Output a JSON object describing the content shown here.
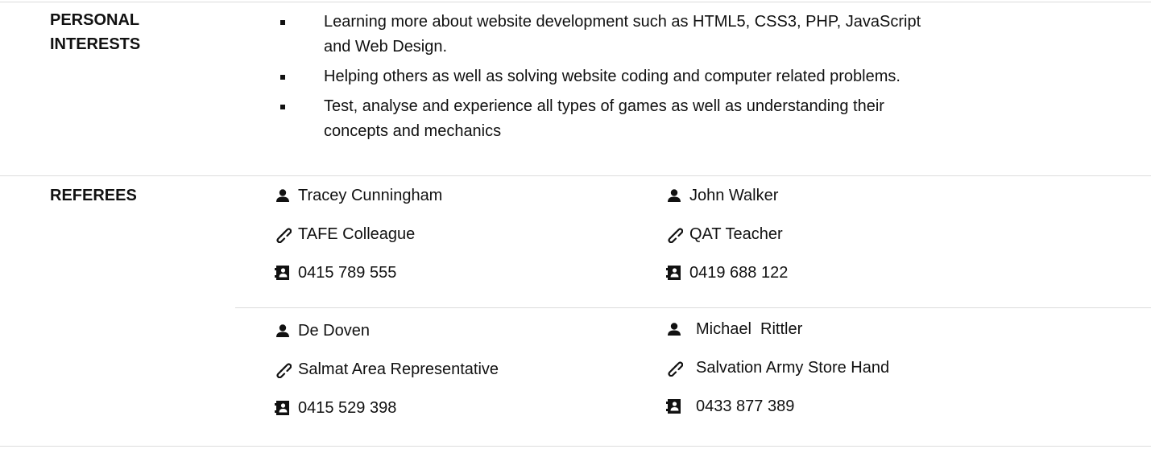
{
  "personal_interests": {
    "heading_line1": "PERSONAL",
    "heading_line2": "INTERESTS",
    "items": [
      {
        "line1": "Learning more about website development such as HTML5, CSS3, PHP, JavaScript",
        "line2": "and Web Design."
      },
      {
        "line1": "Helping others as well as solving website coding and computer related problems.",
        "line2": ""
      },
      {
        "line1": "Test, analyse and experience all types of games as well as understanding their",
        "line2": "concepts and mechanics"
      }
    ]
  },
  "referees": {
    "heading": "REFEREES",
    "people": [
      {
        "name": "Tracey Cunningham",
        "relation": "TAFE Colleague",
        "phone": "0415 789 555"
      },
      {
        "name": "John Walker",
        "relation": "QAT Teacher",
        "phone": "0419 688 122"
      },
      {
        "name": "De Doven",
        "relation": "Salmat Area Representative",
        "phone": "0415 529 398"
      },
      {
        "name": "Michael  Rittler",
        "relation": "Salvation Army Store Hand",
        "phone": "0433 877 389"
      }
    ]
  },
  "icons": {
    "person": "user-icon",
    "relation": "link-icon",
    "phone": "address-book-icon"
  }
}
